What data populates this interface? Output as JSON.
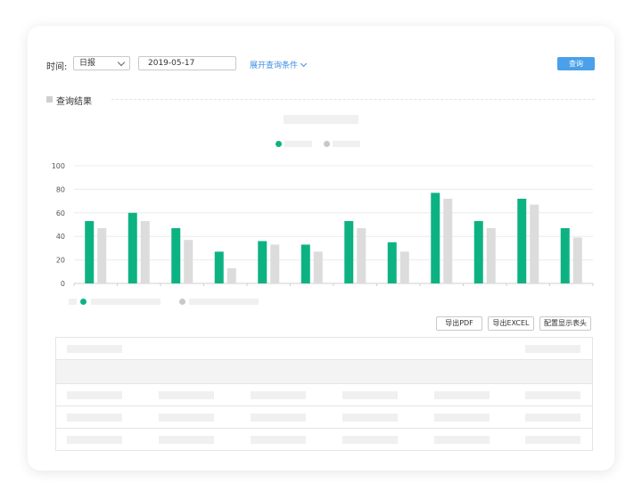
{
  "filter": {
    "time_label": "时间:",
    "period_select": "日报",
    "date_value": "2019-05-17",
    "expand_label": "展开查询条件",
    "query_button": "查询"
  },
  "section": {
    "title": "查询结果"
  },
  "toolbar": {
    "export_pdf": "导出PDF",
    "export_excel": "导出EXCEL",
    "config_header": "配置显示表头"
  },
  "colors": {
    "primary": "#0db283",
    "secondary": "#dcdcdc",
    "accent": "#4aa0ea"
  },
  "chart_data": {
    "type": "bar",
    "categories": [
      "",
      "",
      "",
      "",
      "",
      "",
      "",
      "",
      "",
      "",
      "",
      ""
    ],
    "series": [
      {
        "values": [
          53,
          60,
          47,
          27,
          36,
          33,
          53,
          35,
          77,
          53,
          72,
          47
        ]
      },
      {
        "values": [
          47,
          53,
          37,
          13,
          33,
          27,
          47,
          27,
          72,
          47,
          67,
          39
        ]
      }
    ],
    "yticks": [
      "0",
      "20",
      "40",
      "60",
      "80",
      "100"
    ],
    "ylim": [
      0,
      100
    ],
    "grid": true
  }
}
